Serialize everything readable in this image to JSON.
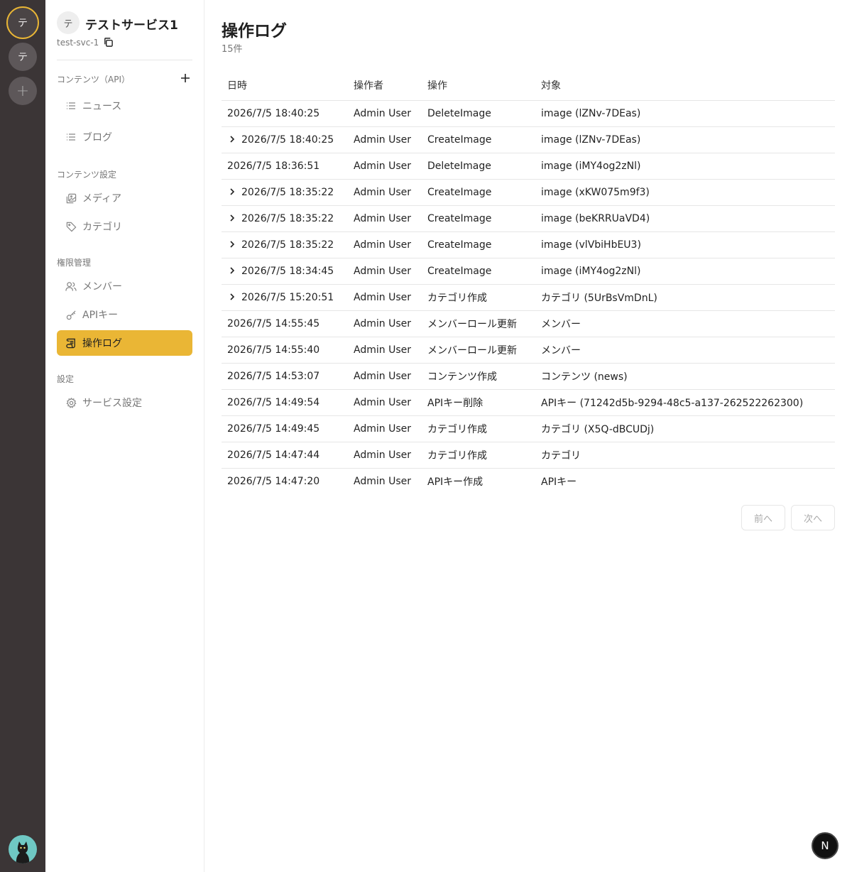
{
  "rail": {
    "services": [
      {
        "initial": "テ",
        "active": true
      },
      {
        "initial": "テ",
        "active": false
      }
    ],
    "add_label": "+"
  },
  "sidebar": {
    "service_initial": "テ",
    "service_name": "テストサービス1",
    "service_slug": "test-svc-1",
    "sections": {
      "content_api": "コンテンツ（API）",
      "content_settings": "コンテンツ設定",
      "permissions": "権限管理",
      "settings": "設定"
    },
    "items": {
      "news": "ニュース",
      "blog": "ブログ",
      "media": "メディア",
      "category": "カテゴリ",
      "members": "メンバー",
      "api_keys": "APIキー",
      "audit_log": "操作ログ",
      "service_settings": "サービス設定"
    }
  },
  "main": {
    "title": "操作ログ",
    "count": "15件",
    "columns": [
      "日時",
      "操作者",
      "操作",
      "対象"
    ],
    "rows": [
      {
        "expandable": false,
        "datetime": "2026/7/5 18:40:25",
        "actor": "Admin User",
        "action": "DeleteImage",
        "target": "image (lZNv-7DEas)"
      },
      {
        "expandable": true,
        "datetime": "2026/7/5 18:40:25",
        "actor": "Admin User",
        "action": "CreateImage",
        "target": "image (lZNv-7DEas)"
      },
      {
        "expandable": false,
        "datetime": "2026/7/5 18:36:51",
        "actor": "Admin User",
        "action": "DeleteImage",
        "target": "image (iMY4og2zNl)"
      },
      {
        "expandable": true,
        "datetime": "2026/7/5 18:35:22",
        "actor": "Admin User",
        "action": "CreateImage",
        "target": "image (xKW075m9f3)"
      },
      {
        "expandable": true,
        "datetime": "2026/7/5 18:35:22",
        "actor": "Admin User",
        "action": "CreateImage",
        "target": "image (beKRRUaVD4)"
      },
      {
        "expandable": true,
        "datetime": "2026/7/5 18:35:22",
        "actor": "Admin User",
        "action": "CreateImage",
        "target": "image (vlVbiHbEU3)"
      },
      {
        "expandable": true,
        "datetime": "2026/7/5 18:34:45",
        "actor": "Admin User",
        "action": "CreateImage",
        "target": "image (iMY4og2zNl)"
      },
      {
        "expandable": true,
        "datetime": "2026/7/5 15:20:51",
        "actor": "Admin User",
        "action": "カテゴリ作成",
        "target": "カテゴリ (5UrBsVmDnL)"
      },
      {
        "expandable": false,
        "datetime": "2026/7/5 14:55:45",
        "actor": "Admin User",
        "action": "メンバーロール更新",
        "target": "メンバー"
      },
      {
        "expandable": false,
        "datetime": "2026/7/5 14:55:40",
        "actor": "Admin User",
        "action": "メンバーロール更新",
        "target": "メンバー"
      },
      {
        "expandable": false,
        "datetime": "2026/7/5 14:53:07",
        "actor": "Admin User",
        "action": "コンテンツ作成",
        "target": "コンテンツ (news)"
      },
      {
        "expandable": false,
        "datetime": "2026/7/5 14:49:54",
        "actor": "Admin User",
        "action": "APIキー削除",
        "target": "APIキー (71242d5b-9294-48c5-a137-262522262300)"
      },
      {
        "expandable": false,
        "datetime": "2026/7/5 14:49:45",
        "actor": "Admin User",
        "action": "カテゴリ作成",
        "target": "カテゴリ (X5Q-dBCUDj)"
      },
      {
        "expandable": false,
        "datetime": "2026/7/5 14:47:44",
        "actor": "Admin User",
        "action": "カテゴリ作成",
        "target": "カテゴリ"
      },
      {
        "expandable": false,
        "datetime": "2026/7/5 14:47:20",
        "actor": "Admin User",
        "action": "APIキー作成",
        "target": "APIキー"
      }
    ],
    "pager": {
      "prev": "前へ",
      "next": "次へ"
    }
  },
  "badge": "N",
  "colors": {
    "accent": "#eab635",
    "rail": "#3b3536"
  }
}
